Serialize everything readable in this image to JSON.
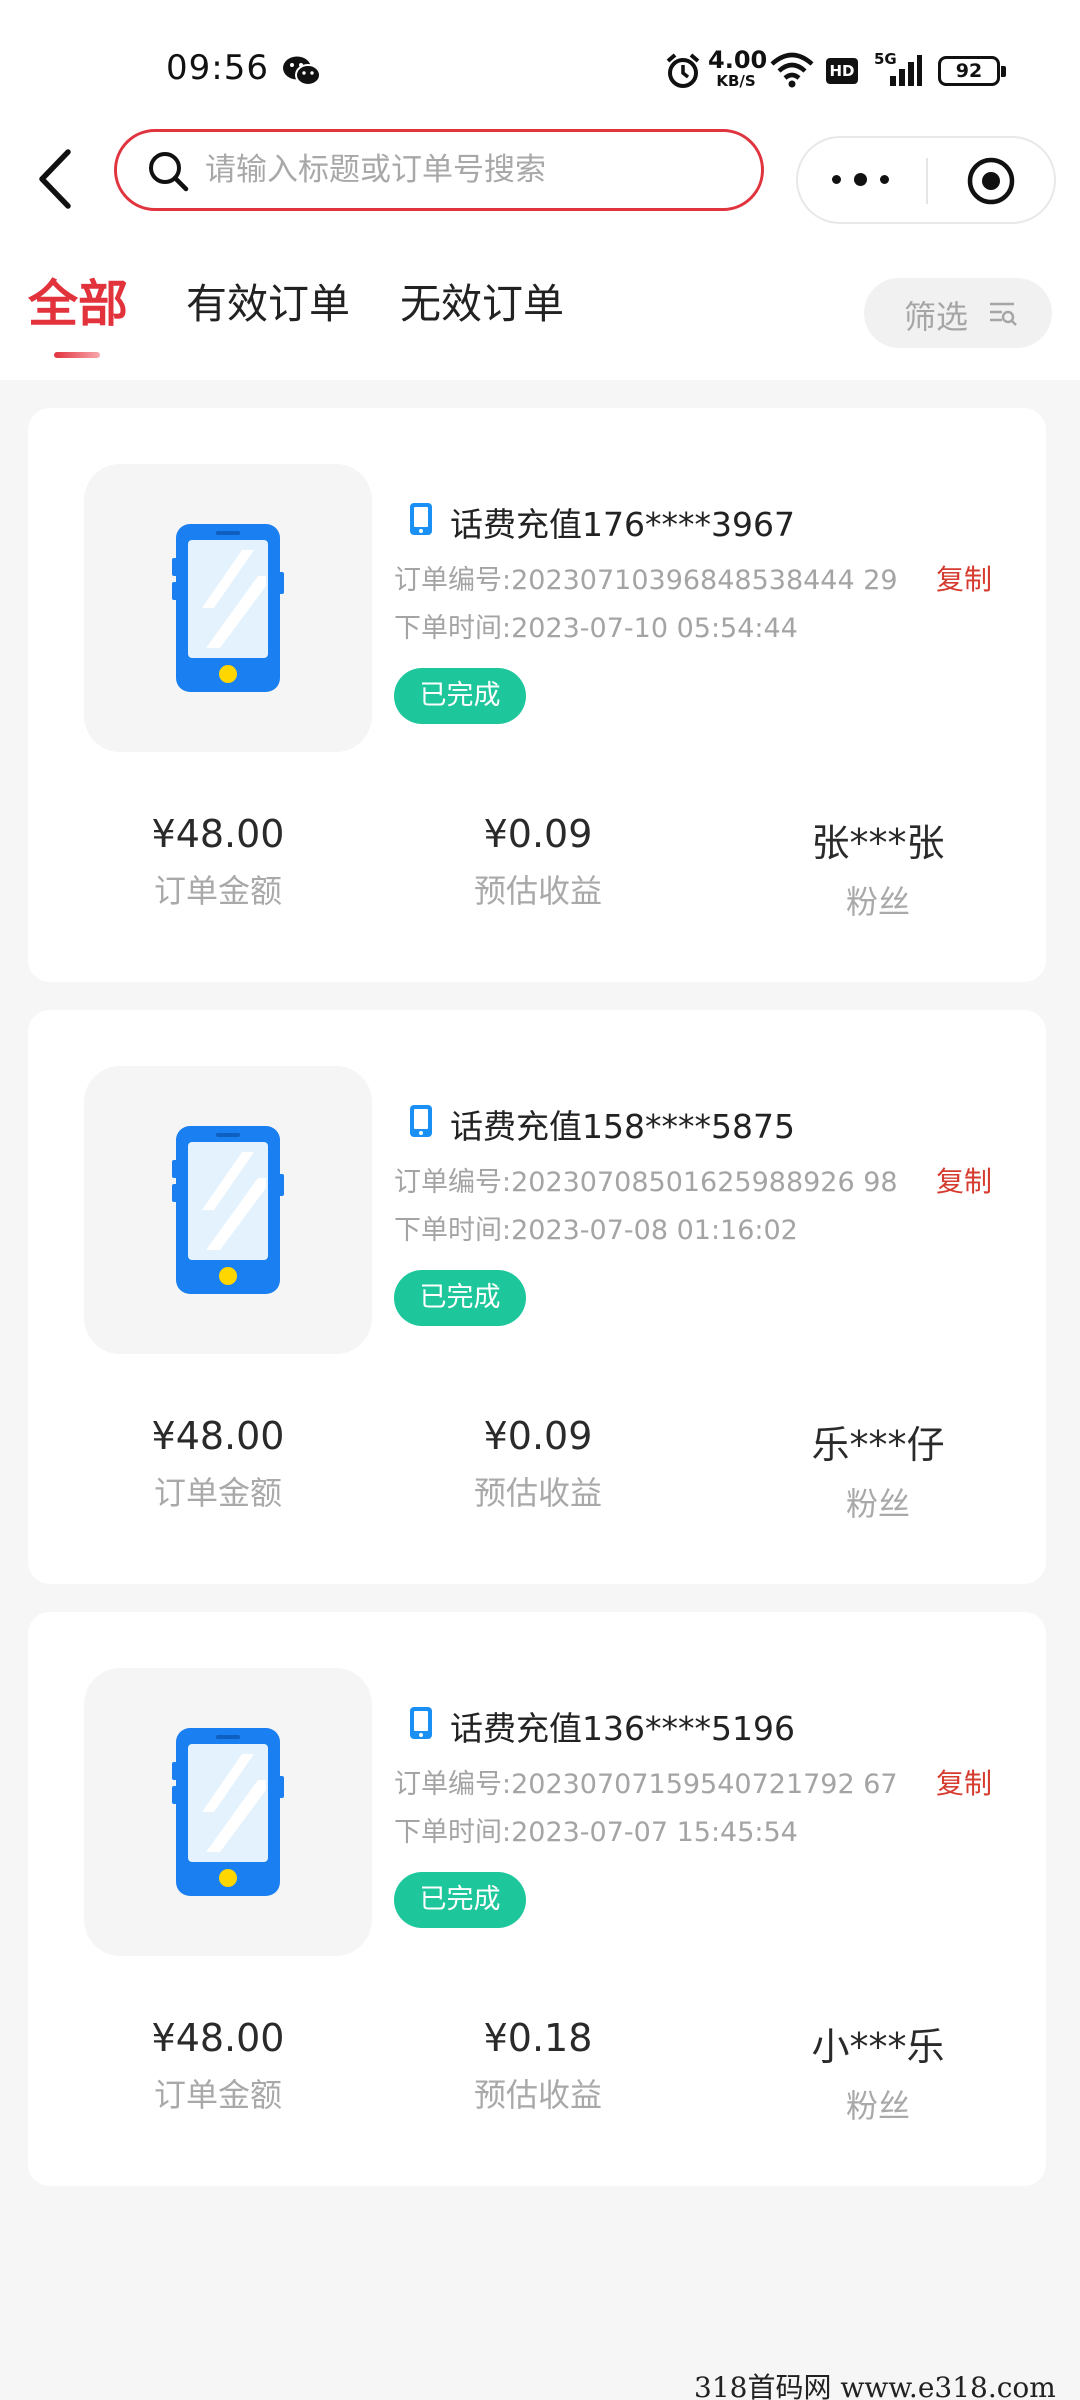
{
  "status_bar": {
    "time": "09:56",
    "net_speed_value": "4.00",
    "net_speed_unit": "KB/S",
    "hd_label": "HD",
    "network_type": "5G",
    "battery": "92"
  },
  "search": {
    "placeholder": "请输入标题或订单号搜索",
    "border_color": "#e0343f"
  },
  "tabs": [
    {
      "label": "全部",
      "active": true
    },
    {
      "label": "有效订单",
      "active": false
    },
    {
      "label": "无效订单",
      "active": false
    }
  ],
  "filter": {
    "label": "筛选"
  },
  "colors": {
    "accent": "#e2333d",
    "status_done": "#1ec79b",
    "copy_text": "#d63b2f",
    "phone_blue": "#1a7ff0"
  },
  "orders": [
    {
      "title": "话费充值176****3967",
      "order_no": "订单编号:20230710396848538444 29",
      "order_time": "下单时间:2023-07-10 05:54:44",
      "copy_label": "复制",
      "status": "已完成",
      "amount": "¥48.00",
      "amount_label": "订单金额",
      "income": "¥0.09",
      "income_label": "预估收益",
      "fan": "张***张",
      "fan_label": "粉丝"
    },
    {
      "title": "话费充值158****5875",
      "order_no": "订单编号:20230708501625988926 98",
      "order_time": "下单时间:2023-07-08 01:16:02",
      "copy_label": "复制",
      "status": "已完成",
      "amount": "¥48.00",
      "amount_label": "订单金额",
      "income": "¥0.09",
      "income_label": "预估收益",
      "fan": "乐***仔",
      "fan_label": "粉丝"
    },
    {
      "title": "话费充值136****5196",
      "order_no": "订单编号:20230707159540721792 67",
      "order_time": "下单时间:2023-07-07 15:45:54",
      "copy_label": "复制",
      "status": "已完成",
      "amount": "¥48.00",
      "amount_label": "订单金额",
      "income": "¥0.18",
      "income_label": "预估收益",
      "fan": "小***乐",
      "fan_label": "粉丝"
    }
  ],
  "watermark": "318首码网  www.e318.com"
}
